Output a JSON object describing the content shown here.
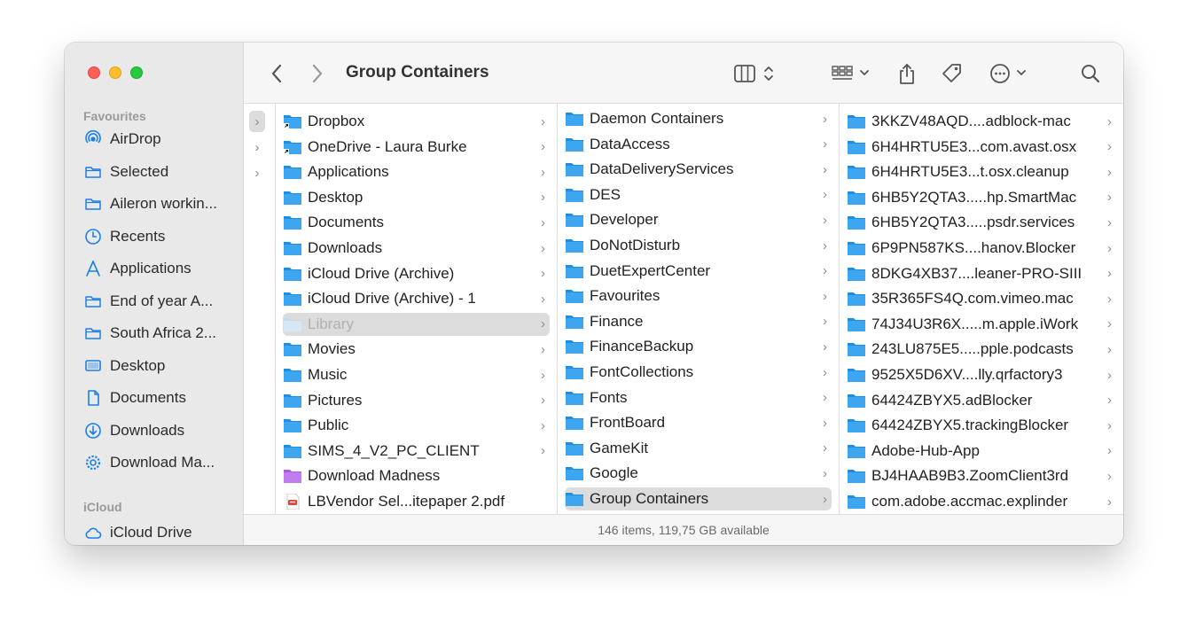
{
  "window": {
    "title": "Group Containers"
  },
  "sidebar": {
    "favourites_heading": "Favourites",
    "icloud_heading": "iCloud",
    "items": [
      {
        "label": "AirDrop",
        "icon": "airdrop-icon"
      },
      {
        "label": "Selected",
        "icon": "folder-icon"
      },
      {
        "label": "Aileron workin...",
        "icon": "folder-icon"
      },
      {
        "label": "Recents",
        "icon": "clock-icon"
      },
      {
        "label": "Applications",
        "icon": "applications-icon"
      },
      {
        "label": "End of year A...",
        "icon": "folder-icon"
      },
      {
        "label": "South Africa 2...",
        "icon": "folder-icon"
      },
      {
        "label": "Desktop",
        "icon": "desktop-icon"
      },
      {
        "label": "Documents",
        "icon": "document-icon"
      },
      {
        "label": "Downloads",
        "icon": "download-icon"
      },
      {
        "label": "Download Ma...",
        "icon": "gear-icon"
      }
    ],
    "icloud_items": [
      {
        "label": "iCloud Drive",
        "icon": "cloud-icon"
      }
    ]
  },
  "columns": {
    "col2": [
      {
        "name": "Dropbox",
        "icon": "folder-alias"
      },
      {
        "name": "OneDrive - Laura Burke",
        "icon": "folder-alias"
      },
      {
        "name": "Applications",
        "icon": "folder"
      },
      {
        "name": "Desktop",
        "icon": "folder"
      },
      {
        "name": "Documents",
        "icon": "folder"
      },
      {
        "name": "Downloads",
        "icon": "folder"
      },
      {
        "name": "iCloud Drive (Archive)",
        "icon": "folder"
      },
      {
        "name": "iCloud Drive (Archive) - 1",
        "icon": "folder"
      },
      {
        "name": "Library",
        "icon": "folder-dim",
        "selected": true,
        "dim": true
      },
      {
        "name": "Movies",
        "icon": "folder"
      },
      {
        "name": "Music",
        "icon": "folder"
      },
      {
        "name": "Pictures",
        "icon": "folder"
      },
      {
        "name": "Public",
        "icon": "folder"
      },
      {
        "name": "SIMS_4_V2_PC_CLIENT",
        "icon": "folder"
      },
      {
        "name": "Download Madness",
        "icon": "folder-purple",
        "no_chevron": true
      },
      {
        "name": "LBVendor Sel...itepaper 2.pdf",
        "icon": "pdf",
        "no_chevron": true
      }
    ],
    "col3": [
      {
        "name": "Daemon Containers"
      },
      {
        "name": "DataAccess"
      },
      {
        "name": "DataDeliveryServices"
      },
      {
        "name": "DES"
      },
      {
        "name": "Developer"
      },
      {
        "name": "DoNotDisturb"
      },
      {
        "name": "DuetExpertCenter"
      },
      {
        "name": "Favourites"
      },
      {
        "name": "Finance"
      },
      {
        "name": "FinanceBackup"
      },
      {
        "name": "FontCollections"
      },
      {
        "name": "Fonts"
      },
      {
        "name": "FrontBoard"
      },
      {
        "name": "GameKit"
      },
      {
        "name": "Google"
      },
      {
        "name": "Group Containers",
        "selected": true
      }
    ],
    "col4": [
      {
        "name": "3KKZV48AQD....adblock-mac"
      },
      {
        "name": "6H4HRTU5E3...com.avast.osx"
      },
      {
        "name": "6H4HRTU5E3...t.osx.cleanup"
      },
      {
        "name": "6HB5Y2QTA3.....hp.SmartMac"
      },
      {
        "name": "6HB5Y2QTA3.....psdr.services"
      },
      {
        "name": "6P9PN587KS....hanov.Blocker"
      },
      {
        "name": "8DKG4XB37....leaner-PRO-SIII"
      },
      {
        "name": "35R365FS4Q.com.vimeo.mac"
      },
      {
        "name": "74J34U3R6X.....m.apple.iWork"
      },
      {
        "name": "243LU875E5.....pple.podcasts"
      },
      {
        "name": "9525X5D6XV....lly.qrfactory3"
      },
      {
        "name": "64424ZBYX5.adBlocker"
      },
      {
        "name": "64424ZBYX5.trackingBlocker"
      },
      {
        "name": "Adobe-Hub-App"
      },
      {
        "name": "BJ4HAAB9B3.ZoomClient3rd"
      },
      {
        "name": "com.adobe.accmac.explinder"
      }
    ]
  },
  "status": {
    "text": "146 items, 119,75 GB available"
  },
  "colors": {
    "folder": "#3ea6f0",
    "folder_dark": "#1d8ee0",
    "selection": "#dcdcdc",
    "accent": "#1a7fe8"
  }
}
